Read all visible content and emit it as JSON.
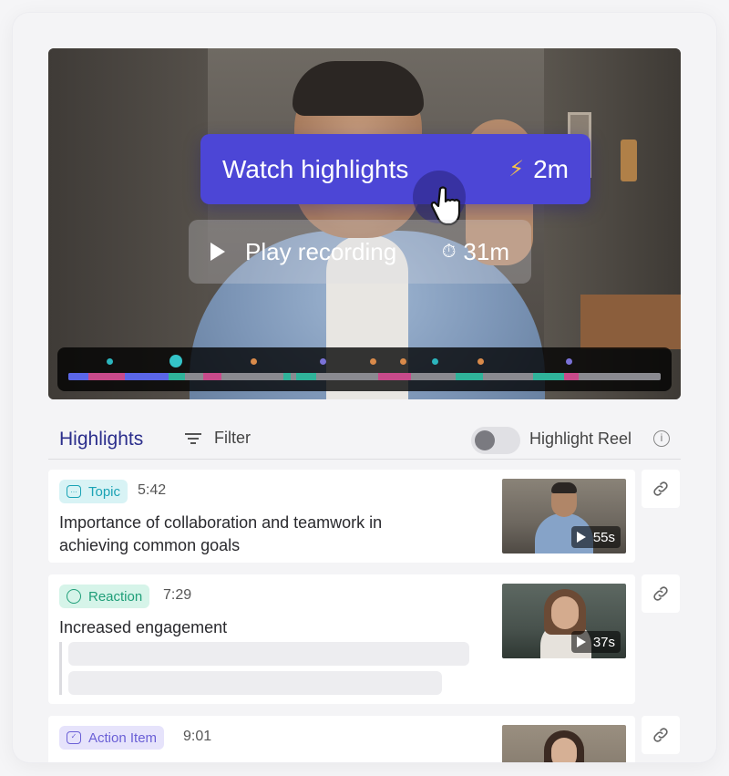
{
  "video": {
    "watch_highlights": {
      "label": "Watch highlights",
      "duration": "2m",
      "icon": "lightning-icon"
    },
    "play_recording": {
      "label": "Play recording",
      "duration": "31m",
      "icon": "stopwatch-icon"
    }
  },
  "header": {
    "title": "Highlights",
    "filter_label": "Filter",
    "reel_label": "Highlight Reel",
    "reel_on": false
  },
  "items": [
    {
      "tag": "Topic",
      "time": "5:42",
      "text": "Importance of collaboration and teamwork in achieving common goals",
      "duration": "55s",
      "tag_color": "#1aa3b5",
      "tag_bg": "#d8f3f5"
    },
    {
      "tag": "Reaction",
      "time": "7:29",
      "text": "Increased engagement",
      "duration": "37s",
      "tag_color": "#1f9e78",
      "tag_bg": "#d6f4e9"
    },
    {
      "tag": "Action Item",
      "time": "9:01",
      "text": "",
      "duration": "",
      "tag_color": "#6a5fd6",
      "tag_bg": "#e6e3fb"
    }
  ],
  "colors": {
    "accent": "#4c46d6",
    "title": "#2b2e8c"
  }
}
